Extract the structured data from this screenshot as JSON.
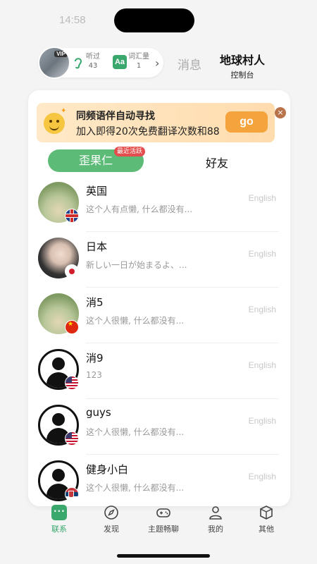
{
  "status": {
    "time": "14:58"
  },
  "header": {
    "listen_label": "听过",
    "listen_value": "43",
    "vocab_label": "词汇量",
    "vocab_value": "1",
    "vip_badge": "VIP",
    "aa_icon_text": "Aa",
    "tabs": [
      {
        "label": "消息"
      },
      {
        "label": "地球村人",
        "sub": "控制台"
      }
    ]
  },
  "banner": {
    "title": "同频语伴自动寻找",
    "subtitle": "加入即得20次免费翻译次数和88",
    "go_label": "go",
    "close_label": "×"
  },
  "segments": {
    "active_label": "歪果仁",
    "badge": "最近活跃",
    "friends_label": "好友"
  },
  "contacts": [
    {
      "name": "英国",
      "message": "这个人有点懒, 什么都没有...",
      "language": "English",
      "flag": "uk"
    },
    {
      "name": "日本",
      "message": "新しい一日が始まるよ、...",
      "language": "English",
      "flag": "jp"
    },
    {
      "name": "消5",
      "message": "这个人很懒, 什么都没有...",
      "language": "English",
      "flag": "cn"
    },
    {
      "name": "消9",
      "message": "123",
      "language": "English",
      "flag": "us"
    },
    {
      "name": "guys",
      "message": "这个人很懒, 什么都没有...",
      "language": "English",
      "flag": "us"
    },
    {
      "name": "健身小白",
      "message": "这个人很懒, 什么都没有...",
      "language": "English",
      "flag": "rs"
    }
  ],
  "nav": [
    {
      "label": "联系",
      "icon": "chat-icon",
      "active": true
    },
    {
      "label": "发现",
      "icon": "compass-icon"
    },
    {
      "label": "主题畅聊",
      "icon": "gamepad-icon"
    },
    {
      "label": "我的",
      "icon": "person-icon"
    },
    {
      "label": "其他",
      "icon": "box-icon"
    }
  ],
  "colors": {
    "accent": "#3aa76d",
    "banner_button": "#f5a33c",
    "badge": "#e34d4d"
  }
}
